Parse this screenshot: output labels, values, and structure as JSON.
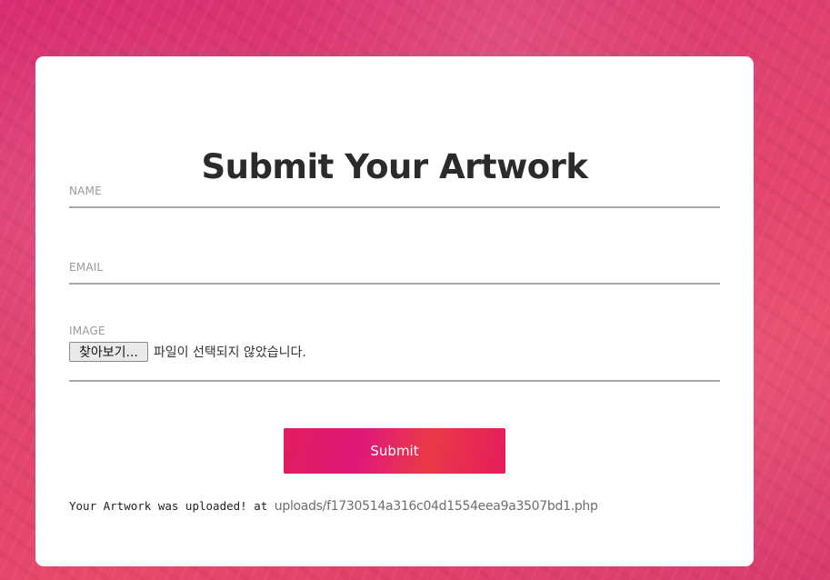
{
  "page": {
    "title": "Submit Your Artwork"
  },
  "form": {
    "name": {
      "label": "NAME",
      "value": ""
    },
    "email": {
      "label": "EMAIL",
      "value": ""
    },
    "image": {
      "label": "IMAGE",
      "button_label": "찾아보기...",
      "status_text": "파일이 선택되지 않았습니다."
    },
    "submit_label": "Submit"
  },
  "upload_result": {
    "message": "Your Artwork was uploaded! at ",
    "path": "uploads/f1730514a316c04d1554eea9a3507bd1.php"
  },
  "colors": {
    "background": "#e0426f",
    "card": "#ffffff",
    "title": "#2b2b2b",
    "button_gradient_start": "#e21d5e",
    "button_gradient_end": "#ea3a48"
  }
}
